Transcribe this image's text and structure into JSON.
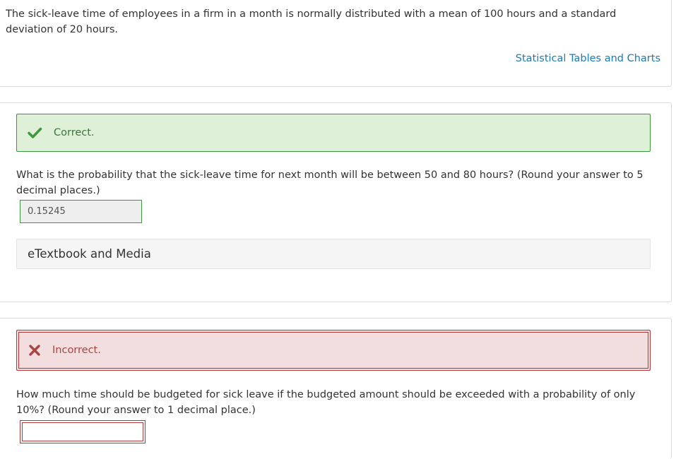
{
  "intro": {
    "text": "The sick-leave time of employees in a firm in a month is normally distributed with a mean of 100 hours and a standard deviation of 20 hours.",
    "tables_link": "Statistical Tables and Charts"
  },
  "colors": {
    "link": "#1a7bb8",
    "correct_bg": "#dff0d8",
    "correct_border": "#3c9a3c",
    "incorrect_bg": "#f2dede",
    "incorrect_border": "#b03a3a"
  },
  "questions": [
    {
      "feedback_icon": "check-icon",
      "feedback_label": "Correct.",
      "text": "What is the probability that the sick-leave time for next month will be between 50 and 80 hours? (Round your answer to 5 decimal places.)",
      "answer_value": "0.15245",
      "media_label": "eTextbook and Media"
    },
    {
      "feedback_icon": "x-icon",
      "feedback_label": "Incorrect.",
      "text": "How much time should be budgeted for sick leave if the budgeted amount should be exceeded with a probability of only 10%? (Round your answer to 1 decimal place.)",
      "answer_value": ""
    }
  ]
}
